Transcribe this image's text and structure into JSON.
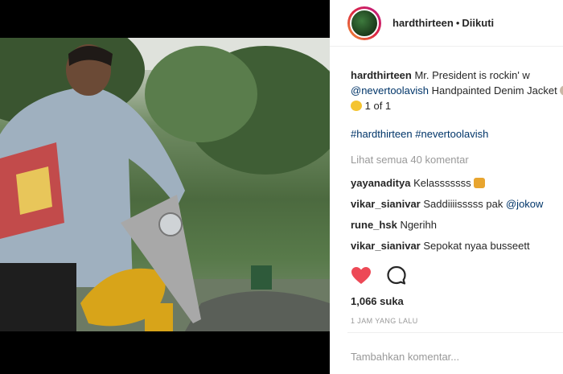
{
  "post_header": {
    "username": "hardthirteen",
    "separator": "•",
    "follow_status": "Diikuti"
  },
  "caption": {
    "username": "hardthirteen",
    "text_part1": "Mr. President is rockin' w",
    "mention": "@nevertoolavish",
    "text_part2": "Handpainted Denim Jacket",
    "text_part3": "1 of 1",
    "hashtag1": "#hardthirteen",
    "hashtag2": "#nevertoolavish"
  },
  "view_all_comments": "Lihat semua 40 komentar",
  "comments": [
    {
      "user": "yayanaditya",
      "text": "Kelasssssss",
      "mention": ""
    },
    {
      "user": "vikar_sianivar",
      "text": "Saddiiiisssss pak",
      "mention": "@jokow"
    },
    {
      "user": "rune_hsk",
      "text": "Ngerihh",
      "mention": ""
    },
    {
      "user": "vikar_sianivar",
      "text": "Sepokat nyaa busseett",
      "mention": ""
    }
  ],
  "likes": "1,066 suka",
  "timestamp": "1 JAM YANG LALU",
  "add_comment_placeholder": "Tambahkan komentar...",
  "icons": {
    "like": "heart-icon",
    "comment": "speech-bubble-icon"
  },
  "colors": {
    "like_red": "#ed4956",
    "link_blue": "#003569",
    "muted": "#999999"
  },
  "carousel": {
    "count": 4,
    "active_index": 3
  }
}
